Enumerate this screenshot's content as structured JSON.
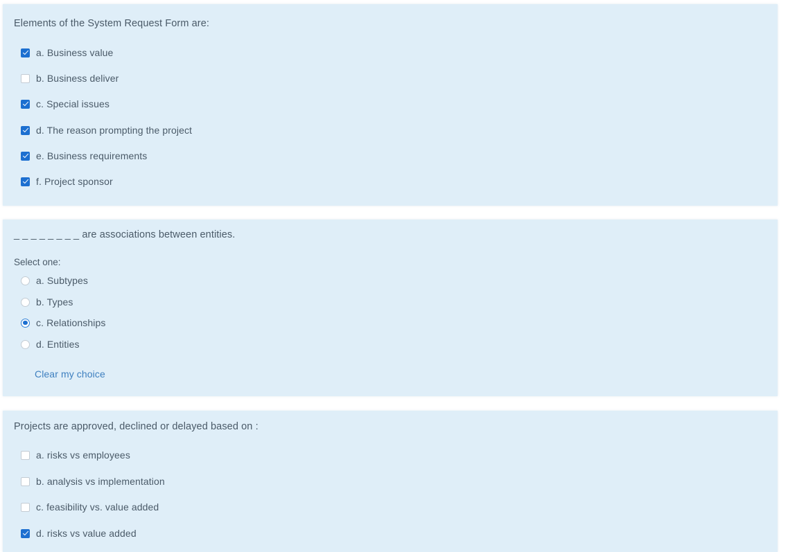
{
  "questions": [
    {
      "id": "q1",
      "prompt": "Elements of the System Request Form are:",
      "input_type": "checkbox",
      "options": [
        {
          "label": "a. Business value",
          "checked": true
        },
        {
          "label": "b. Business deliver",
          "checked": false
        },
        {
          "label": "c. Special issues",
          "checked": true
        },
        {
          "label": "d. The reason prompting the project",
          "checked": true
        },
        {
          "label": "e. Business requirements",
          "checked": true
        },
        {
          "label": "f. Project sponsor",
          "checked": true
        }
      ]
    },
    {
      "id": "q2",
      "prompt": "_ _ _ _ _ _ _ _ are associations between entities.",
      "select_label": "Select one:",
      "input_type": "radio",
      "options": [
        {
          "label": "a. Subtypes",
          "checked": false
        },
        {
          "label": "b. Types",
          "checked": false
        },
        {
          "label": "c. Relationships",
          "checked": true
        },
        {
          "label": "d. Entities",
          "checked": false
        }
      ],
      "clear_label": "Clear my choice"
    },
    {
      "id": "q3",
      "prompt": "Projects are approved, declined or delayed based on :",
      "input_type": "checkbox",
      "options": [
        {
          "label": "a. risks vs employees",
          "checked": false
        },
        {
          "label": "b. analysis vs implementation",
          "checked": false
        },
        {
          "label": "c. feasibility vs. value added",
          "checked": false
        },
        {
          "label": "d. risks vs value added",
          "checked": true
        }
      ]
    }
  ],
  "colors": {
    "panel_background": "#dfeef8",
    "page_background": "#ffffff",
    "text": "#4a5a68",
    "accent": "#1c6fd0",
    "link": "#3d7fbf",
    "control_border": "#c3ccd4"
  }
}
